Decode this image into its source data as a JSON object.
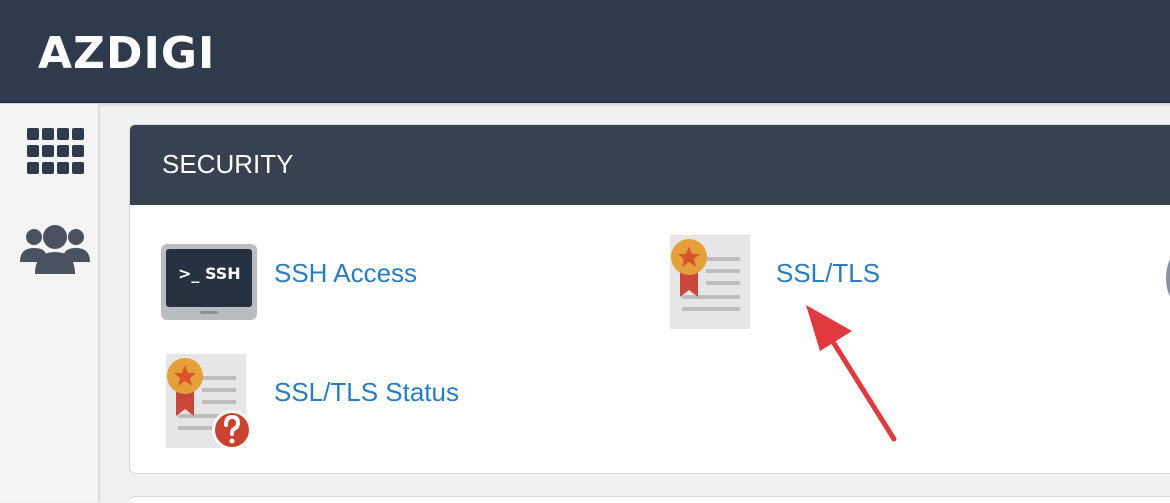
{
  "app": {
    "brand": "AZDIGI"
  },
  "sidebar": {
    "items": [
      {
        "icon": "grid-icon"
      },
      {
        "icon": "users-icon"
      }
    ]
  },
  "security": {
    "title": "SECURITY",
    "items": [
      {
        "label": "SSH Access",
        "icon": "ssh-terminal-icon",
        "icon_text": ">_ SSH"
      },
      {
        "label": "SSL/TLS",
        "icon": "certificate-icon"
      },
      {
        "label": "SSL/TLS Status",
        "icon": "certificate-question-icon"
      }
    ]
  },
  "colors": {
    "topbar": "#2f3b4c",
    "panel_header": "#37414f",
    "link": "#2c7cc0",
    "badge": "#e6a03a",
    "ribbon": "#c9463c",
    "arrow": "#e0393e"
  }
}
